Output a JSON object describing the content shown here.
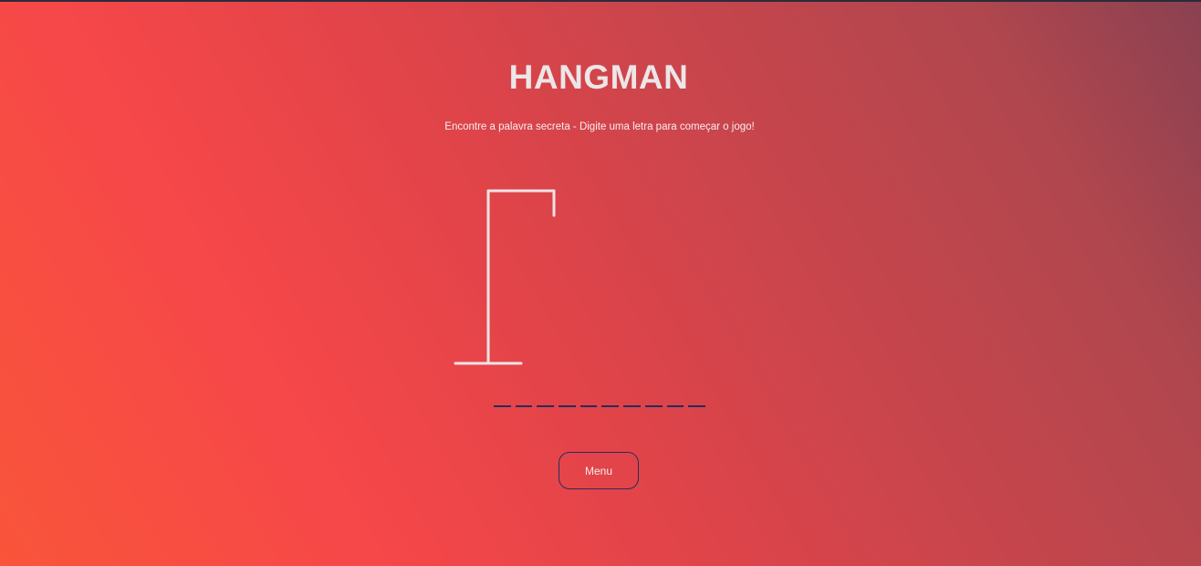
{
  "game": {
    "title": "HANGMAN",
    "instructions": "Encontre a palavra secreta - Digite uma letra para começar o jogo!",
    "word_slots": [
      "",
      "",
      "",
      "",
      "",
      "",
      "",
      "",
      "",
      ""
    ],
    "mistakes": 0,
    "menu_label": "Menu"
  },
  "colors": {
    "gradient_start": "#f9553a",
    "gradient_end": "#8a4151",
    "text": "#ece6e7",
    "slot_underline": "#252c5b",
    "gallows": "#efe3e5"
  }
}
